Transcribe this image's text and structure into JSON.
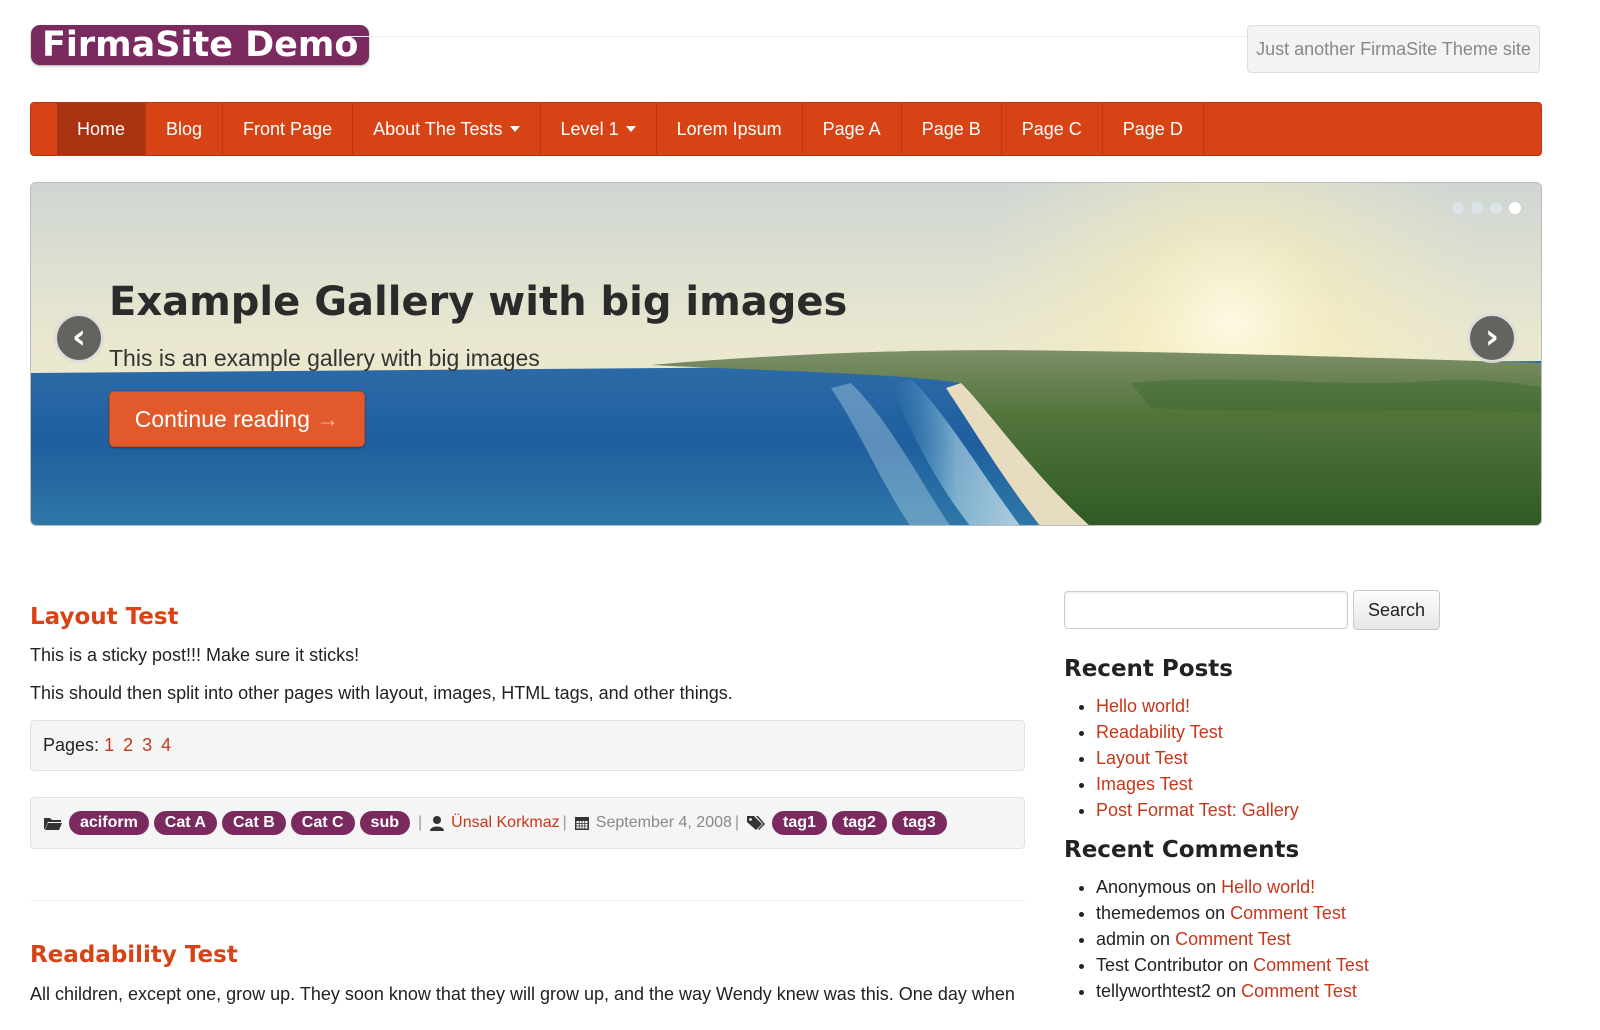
{
  "site": {
    "title": "FirmaSite Demo",
    "tagline": "Just another FirmaSite Theme site"
  },
  "nav": [
    {
      "label": "Home",
      "active": true
    },
    {
      "label": "Blog"
    },
    {
      "label": "Front Page"
    },
    {
      "label": "About The Tests",
      "dropdown": true
    },
    {
      "label": "Level 1",
      "dropdown": true
    },
    {
      "label": "Lorem Ipsum"
    },
    {
      "label": "Page A"
    },
    {
      "label": "Page B"
    },
    {
      "label": "Page C"
    },
    {
      "label": "Page D"
    }
  ],
  "slider": {
    "title": "Example Gallery with big images",
    "subtitle": "This is an example gallery with big images",
    "button": "Continue reading",
    "button_arrow": "→",
    "prev_glyph": "‹",
    "next_glyph": "›",
    "active_slide": 4,
    "slide_count": 4
  },
  "posts": [
    {
      "title": "Layout Test",
      "paragraphs": [
        "This is a sticky post!!! Make sure it sticks!",
        "This should then split into other pages with layout, images, HTML tags, and other things."
      ],
      "pages_label": "Pages:",
      "pages": [
        "1",
        "2",
        "3",
        "4"
      ],
      "categories": [
        "aciform",
        "Cat A",
        "Cat B",
        "Cat C",
        "sub"
      ],
      "author": "Ünsal Korkmaz",
      "date": "September 4, 2008",
      "tags": [
        "tag1",
        "tag2",
        "tag3"
      ],
      "separator": "|"
    },
    {
      "title": "Readability Test",
      "excerpt": "All children, except one, grow up. They soon know that they will grow up, and the way Wendy knew was this. One day when"
    }
  ],
  "sidebar": {
    "search_button": "Search",
    "search_value": "",
    "recent_posts_title": "Recent Posts",
    "recent_posts": [
      "Hello world!",
      "Readability Test",
      "Layout Test",
      "Images Test",
      "Post Format Test: Gallery"
    ],
    "recent_comments_title": "Recent Comments",
    "on_word": "on",
    "recent_comments": [
      {
        "author": "Anonymous",
        "post": "Hello world!"
      },
      {
        "author": "themedemos",
        "post": "Comment Test"
      },
      {
        "author": "admin",
        "post": "Comment Test"
      },
      {
        "author": "Test Contributor",
        "post": "Comment Test"
      },
      {
        "author": "tellyworthtest2",
        "post": "Comment Test"
      }
    ]
  },
  "colors": {
    "brand": "#7a2a5e",
    "nav": "#d84315",
    "nav_active": "#a93311",
    "link": "#c8361a",
    "post_title": "#d84315",
    "button": "#e25a2b"
  },
  "icons": [
    "folder-icon",
    "user-icon",
    "calendar-icon",
    "tags-icon",
    "caret-down-icon",
    "chevron-left-icon",
    "chevron-right-icon"
  ]
}
